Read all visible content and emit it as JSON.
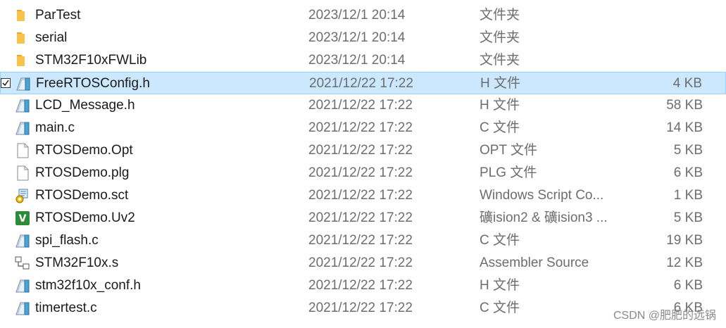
{
  "files": [
    {
      "name": "ParTest",
      "date": "2023/12/1 20:14",
      "type": "文件夹",
      "size": "",
      "icon": "folder-icon"
    },
    {
      "name": "serial",
      "date": "2023/12/1 20:14",
      "type": "文件夹",
      "size": "",
      "icon": "folder-icon"
    },
    {
      "name": "STM32F10xFWLib",
      "date": "2023/12/1 20:14",
      "type": "文件夹",
      "size": "",
      "icon": "folder-icon"
    },
    {
      "name": "FreeRTOSConfig.h",
      "date": "2021/12/22 17:22",
      "type": "H 文件",
      "size": "4 KB",
      "icon": "source-file-icon",
      "selected": true
    },
    {
      "name": "LCD_Message.h",
      "date": "2021/12/22 17:22",
      "type": "H 文件",
      "size": "58 KB",
      "icon": "source-file-icon"
    },
    {
      "name": "main.c",
      "date": "2021/12/22 17:22",
      "type": "C 文件",
      "size": "14 KB",
      "icon": "source-file-icon"
    },
    {
      "name": "RTOSDemo.Opt",
      "date": "2021/12/22 17:22",
      "type": "OPT 文件",
      "size": "5 KB",
      "icon": "blank-file-icon"
    },
    {
      "name": "RTOSDemo.plg",
      "date": "2021/12/22 17:22",
      "type": "PLG 文件",
      "size": "6 KB",
      "icon": "blank-file-icon"
    },
    {
      "name": "RTOSDemo.sct",
      "date": "2021/12/22 17:22",
      "type": "Windows Script Co...",
      "size": "1 KB",
      "icon": "script-file-icon"
    },
    {
      "name": "RTOSDemo.Uv2",
      "date": "2021/12/22 17:22",
      "type": "礦ision2 & 礦ision3 ...",
      "size": "5 KB",
      "icon": "uvision-icon"
    },
    {
      "name": "spi_flash.c",
      "date": "2021/12/22 17:22",
      "type": "C 文件",
      "size": "19 KB",
      "icon": "source-file-icon"
    },
    {
      "name": "STM32F10x.s",
      "date": "2021/12/22 17:22",
      "type": "Assembler Source",
      "size": "12 KB",
      "icon": "assembler-file-icon"
    },
    {
      "name": "stm32f10x_conf.h",
      "date": "2021/12/22 17:22",
      "type": "H 文件",
      "size": "6 KB",
      "icon": "source-file-icon"
    },
    {
      "name": "timertest.c",
      "date": "2021/12/22 17:22",
      "type": "C 文件",
      "size": "6 KB",
      "icon": "source-file-icon"
    }
  ],
  "watermark": "CSDN @肥肥的远锅",
  "colors": {
    "selection_bg": "#cce8ff",
    "selection_border": "#99d1ff",
    "muted_text": "#6d6d6d",
    "folder": "#f8c34a"
  }
}
